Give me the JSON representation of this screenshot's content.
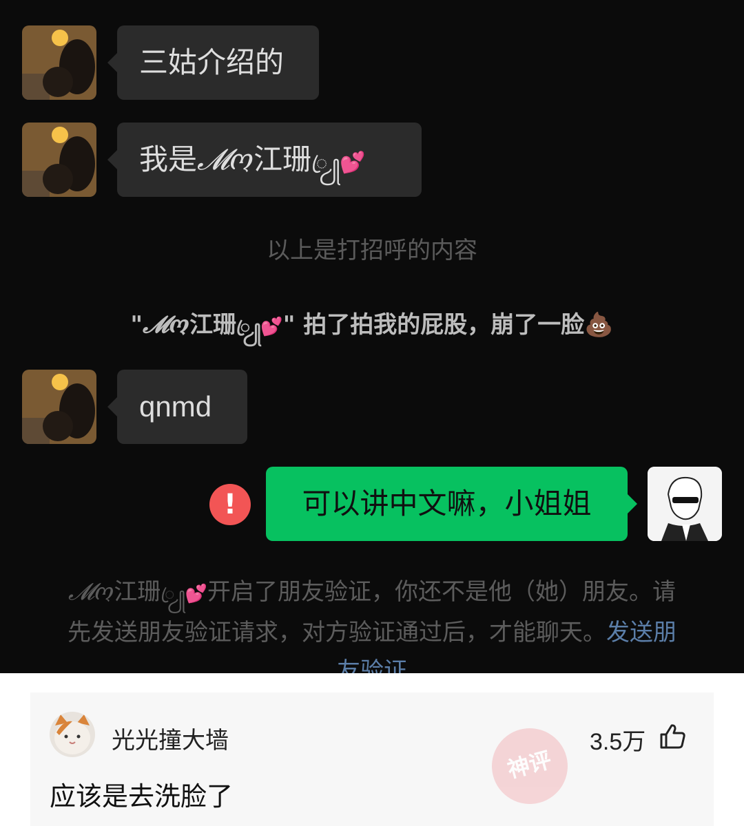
{
  "messages": [
    {
      "text": "三姑介绍的"
    },
    {
      "text_prefix": "我是",
      "name_fancy": "𝓜ო",
      "name_cjk": "江珊",
      "name_ornament": "ꦿ ꦾ",
      "heart": "💕"
    },
    {
      "text": "qnmd"
    }
  ],
  "greeting_hint": "以上是打招呼的内容",
  "nudge": {
    "quote_open": "\"",
    "name_fancy": "𝓜ო",
    "name_cjk": "江珊",
    "name_ornament": "ꦿ ꦾ",
    "heart": "💕",
    "action": "\" 拍了拍我的屁股，崩了一脸",
    "emoji": "💩"
  },
  "self_message": {
    "text": "可以讲中文嘛，小姐姐",
    "status_icon": "!"
  },
  "verify_notice": {
    "name_fancy": "𝓜ო",
    "name_cjk": "江珊",
    "name_ornament": "ꦿ ꦾ",
    "heart": "💕",
    "text": "开启了朋友验证，你还不是他（她）朋友。请先发送朋友验证请求，对方验证通过后，才能聊天。",
    "link": "发送朋友验证"
  },
  "comment": {
    "username": "光光撞大墙",
    "likes": "3.5万",
    "text": "应该是去洗脸了",
    "stamp": "神评"
  },
  "colors": {
    "chat_bg": "#0b0b0b",
    "bubble_other": "#2b2b2b",
    "bubble_self": "#07c160",
    "error_red": "#f25555",
    "link": "#5b7ea8"
  }
}
